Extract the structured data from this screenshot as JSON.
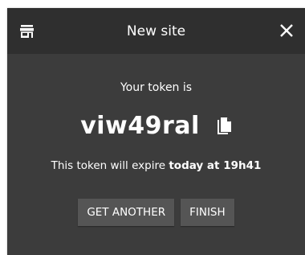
{
  "dialog": {
    "title": "New site",
    "close_icon": "close-icon",
    "store_icon": "store-icon"
  },
  "token": {
    "label": "Your token is",
    "value": "viw49ral",
    "copy_icon": "copy-icon",
    "expire_prefix": "This token will expire",
    "expire_when": "today at 19h41"
  },
  "buttons": {
    "get_another": "GET ANOTHER",
    "finish": "FINISH"
  },
  "colors": {
    "titlebar": "#2f2f2f",
    "body": "#3c3c3c",
    "button": "#555555",
    "text": "#ffffff"
  }
}
